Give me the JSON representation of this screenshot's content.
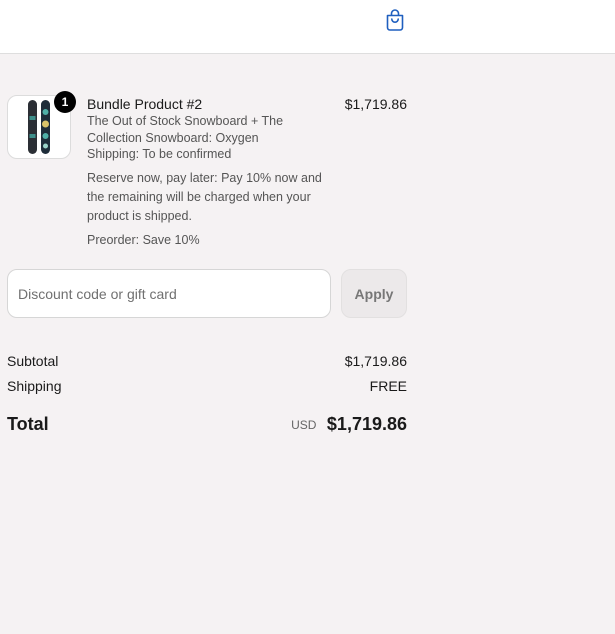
{
  "header": {
    "cart_icon": "shopping-bag-icon",
    "accent_color": "#1f5fbf"
  },
  "line_item": {
    "quantity": "1",
    "title": "Bundle Product #2",
    "components": "The Out of Stock Snowboard + The Collection Snowboard: Oxygen",
    "shipping": "Shipping: To be confirmed",
    "note": "Reserve now, pay later: Pay 10% now and the remaining will be charged when your product is shipped.",
    "preorder": "Preorder: Save 10%",
    "price": "$1,719.86",
    "thumbnail_icon": "snowboard-image"
  },
  "discount": {
    "placeholder": "Discount code or gift card",
    "value": "",
    "apply_label": "Apply"
  },
  "summary": {
    "subtotal_label": "Subtotal",
    "subtotal_value": "$1,719.86",
    "shipping_label": "Shipping",
    "shipping_value": "FREE",
    "total_label": "Total",
    "total_currency": "USD",
    "total_value": "$1,719.86"
  }
}
